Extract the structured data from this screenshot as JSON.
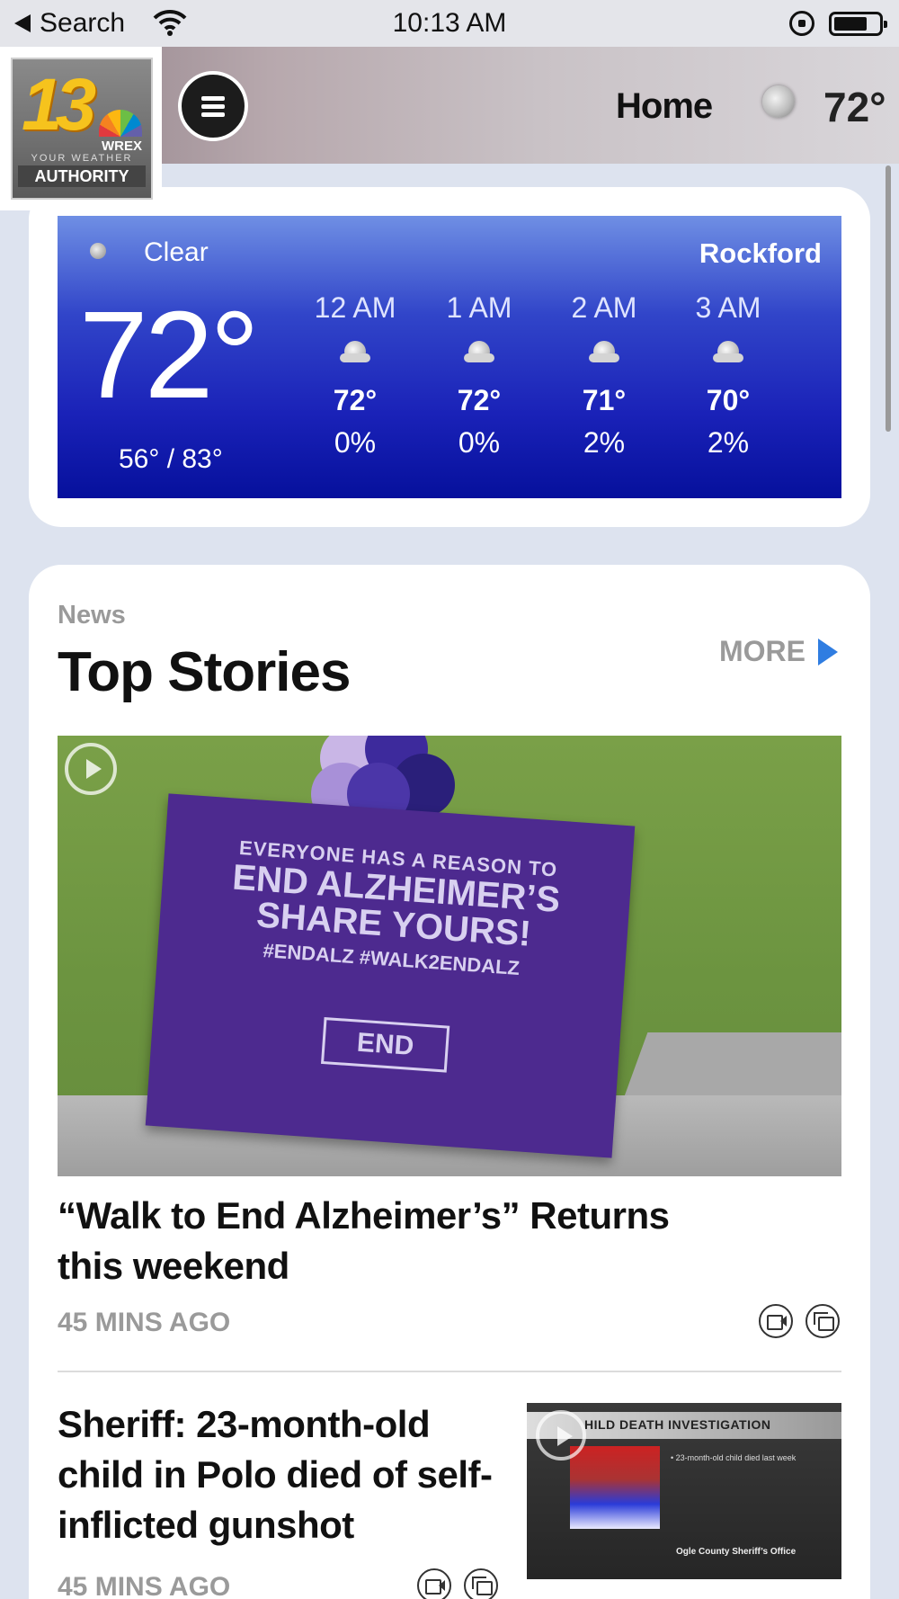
{
  "status_bar": {
    "back_label": "Search",
    "time": "10:13 AM"
  },
  "header": {
    "logo": {
      "number": "13",
      "call_sign": "WREX",
      "tagline": "YOUR WEATHER",
      "authority": "AUTHORITY"
    },
    "title": "Home",
    "temperature": "72°"
  },
  "weather": {
    "condition": "Clear",
    "city": "Rockford",
    "current_temp": "72°",
    "hi_lo": "56° / 83°",
    "hourly": [
      {
        "time": "12 AM",
        "temp": "72°",
        "precip": "0%"
      },
      {
        "time": "1 AM",
        "temp": "72°",
        "precip": "0%"
      },
      {
        "time": "2 AM",
        "temp": "71°",
        "precip": "2%"
      },
      {
        "time": "3 AM",
        "temp": "70°",
        "precip": "2%"
      }
    ]
  },
  "news": {
    "section": "News",
    "title": "Top Stories",
    "more_label": "MORE",
    "stories": [
      {
        "headline": "“Walk to End Alzheimer’s” Returns this weekend",
        "time": "45 MINS AGO",
        "image_sign": {
          "line1": "EVERYONE HAS A REASON TO",
          "line2": "END ALZHEIMER’S",
          "line3": "SHARE YOURS!",
          "line4": "#ENDALZ #WALK2ENDALZ",
          "logo": "END"
        }
      },
      {
        "headline": "Sheriff: 23-month-old child in Polo died of self-inflicted gunshot",
        "time": "45 MINS AGO",
        "thumb": {
          "banner": "HILD DEATH INVESTIGATION",
          "subtext": "• 23-month-old child died last week",
          "footer": "Ogle County Sheriff’s Office"
        }
      }
    ]
  }
}
